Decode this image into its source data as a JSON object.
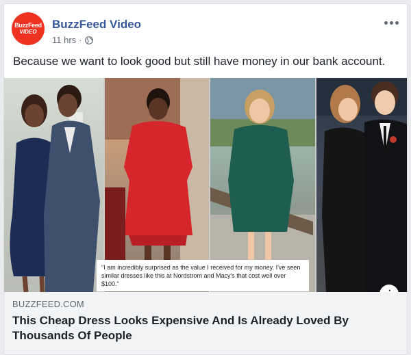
{
  "post": {
    "avatar_line1": "BuzzFeed",
    "avatar_line2": "VIDEO",
    "page_name": "BuzzFeed Video",
    "time": "11 hrs",
    "separator": "·",
    "privacy_icon": "globe-icon",
    "more_icon": "ellipsis-icon",
    "status_text": "Because we want to look good but still have money in our bank account."
  },
  "image": {
    "quote": "\"I am incredibly surprised as the value I received for my money. I've seen similar dresses like this at Nordstrom and Macy's that cost well over $100.\"",
    "info_label": "i"
  },
  "link": {
    "domain": "BUZZFEED.COM",
    "headline": "This Cheap Dress Looks Expensive And Is Already Loved By Thousands Of People"
  },
  "colors": {
    "brand_red": "#ee3322",
    "link_blue": "#365899",
    "text": "#1d2129",
    "muted": "#606770",
    "link_bg": "#f2f3f5"
  }
}
